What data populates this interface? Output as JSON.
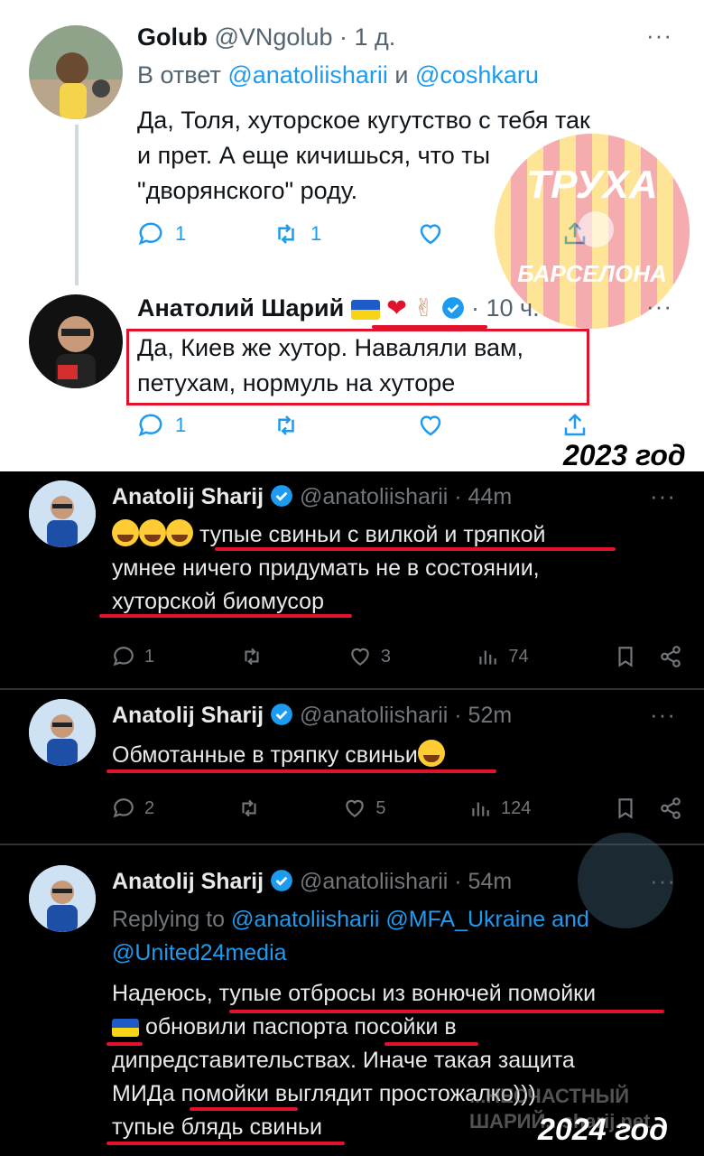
{
  "colors": {
    "accent": "#1d9bf0",
    "red_underline": "#e0122c",
    "light_bg": "#ffffff",
    "dark_bg": "#000000"
  },
  "top_thread": {
    "year_label": "2023 год",
    "watermark": {
      "line1": "ТРУХА",
      "line2": "БАРСЕЛОНА"
    },
    "tweet1": {
      "name": "Golub",
      "handle": "@VNgolub · 1 д.",
      "reply_prefix": "В ответ",
      "reply_user1": "@anatoliisharii",
      "reply_and": "и",
      "reply_user2": "@coshkaru",
      "line1": "Да, Толя, хуторское кугутство с тебя так",
      "line2": "и прет. А еще кичишься, что ты",
      "line3": "\"дворянского\" роду.",
      "replies": "1",
      "retweets": "1",
      "likes": ""
    },
    "tweet2": {
      "name": "Анатолий Шарий",
      "time": "· 10 ч.",
      "line1": "Да, Киев же хутор. Наваляли вам,",
      "line2": "петухам, нормуль на хуторе",
      "replies": "1",
      "retweets": "",
      "likes": ""
    }
  },
  "bottom_thread": {
    "year_label": "2024 год",
    "watermark_text": "...НЕСЧАСТНЫЙ\nШАРИЙ...sharij.net",
    "tweet1": {
      "name": "Anatolij Sharij",
      "handle": "@anatoliisharii · 44m",
      "line1_text": "тупые свиньи с вилкой и тряпкой",
      "line2": "умнее ничего придумать не в состоянии,",
      "line3": "хуторской биомусор",
      "replies": "1",
      "retweets": "",
      "likes": "3",
      "views": "74"
    },
    "tweet2": {
      "name": "Anatolij Sharij",
      "handle": "@anatoliisharii · 52m",
      "line1": "Обмотанные в тряпку свиньи",
      "replies": "2",
      "retweets": "",
      "likes": "5",
      "views": "124"
    },
    "tweet3": {
      "name": "Anatolij Sharij",
      "handle": "@anatoliisharii · 54m",
      "replying_to": "Replying to",
      "reply_users": "@anatoliisharii @MFA_Ukraine and",
      "reply_users2": "@United24media",
      "line1": "Надеюсь, тупые отбросы из вонючей помойки",
      "line2": "обновили паспорта посойки в",
      "line3": "дипредставительствах. Иначе такая защита",
      "line4": "МИДа помойки выглядит простожалко)))",
      "line5": "тупые блядь свиньи"
    }
  }
}
